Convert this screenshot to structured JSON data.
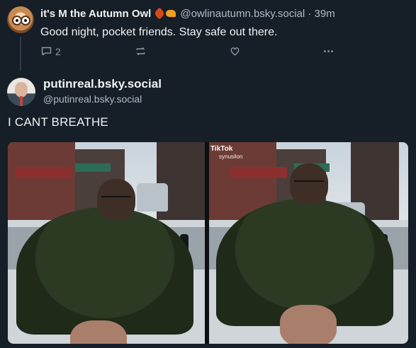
{
  "parent_post": {
    "name": "it's M the Autumn Owl",
    "handle": "@owlinautumn.bsky.social",
    "time": "· 39m",
    "text": "Good night, pocket friends. Stay safe out there.",
    "reply_count": "2",
    "icons": [
      "reply-icon",
      "repost-icon",
      "like-icon",
      "more-icon"
    ]
  },
  "main_post": {
    "display_name": "putinreal.bsky.social",
    "handle": "@putinreal.bsky.social",
    "text": "I CANT BREATHE",
    "media": {
      "watermark": "TikTok",
      "watermark_user": "synusilon"
    }
  },
  "colors": {
    "background": "#161e27",
    "text": "#f1f3f5",
    "muted": "#aebbc9",
    "icon": "#8c9aa9"
  }
}
